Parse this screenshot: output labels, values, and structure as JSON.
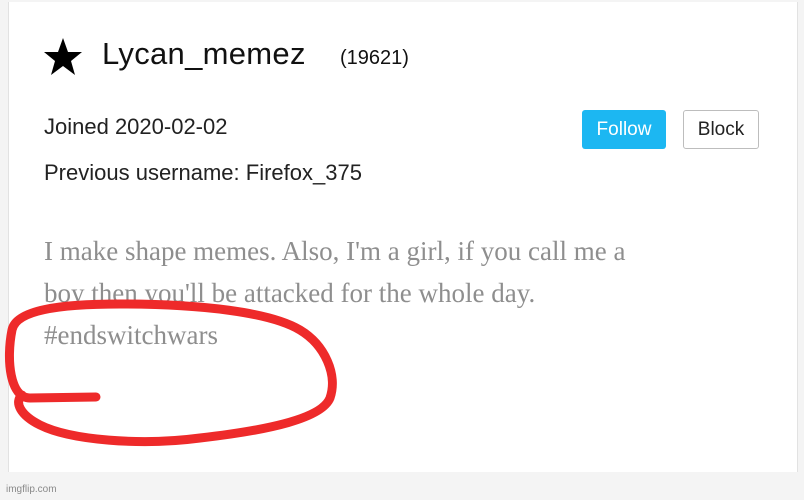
{
  "profile": {
    "star_icon": "star-icon",
    "username": "Lycan_memez",
    "points": "(19621)",
    "joined": "Joined 2020-02-02",
    "previous_username": "Previous username: Firefox_375",
    "bio_lines": [
      "I make shape memes. Also, I'm a girl, if you call me a",
      "boy then you'll be attacked for the whole day.",
      "#endswitchwars"
    ]
  },
  "actions": {
    "follow_label": "Follow",
    "block_label": "Block"
  },
  "annotation": {
    "scribble_color": "#ee2a2a"
  },
  "watermark": "imgflip.com",
  "colors": {
    "follow_bg": "#1cb7f2",
    "bio_text": "#8e8e8e"
  }
}
